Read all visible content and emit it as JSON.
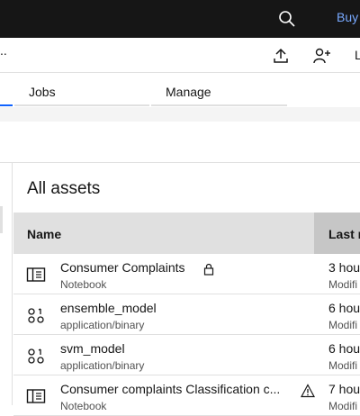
{
  "topbar": {
    "buy_label": "Buy"
  },
  "toolbar": {
    "breadcrumb_ellipsis": "..",
    "more_label": "L"
  },
  "tabs": [
    {
      "label": "Jobs"
    },
    {
      "label": "Manage"
    }
  ],
  "assets": {
    "title": "All assets",
    "columns": {
      "name": "Name",
      "last_modified": "Last m"
    },
    "rows": [
      {
        "name": "Consumer Complaints",
        "type": "Notebook",
        "time": "3 hou",
        "modified": "Modifi",
        "icon": "notebook-icon",
        "badge": "lock-icon"
      },
      {
        "name": "ensemble_model",
        "type": "application/binary",
        "time": "6 hou",
        "modified": "Modifi",
        "icon": "model-icon"
      },
      {
        "name": "svm_model",
        "type": "application/binary",
        "time": "6 hou",
        "modified": "Modifi",
        "icon": "model-icon"
      },
      {
        "name": "Consumer complaints Classification c...",
        "type": "Notebook",
        "time": "7 hou",
        "modified": "Modifi",
        "icon": "notebook-icon",
        "badge": "warning-icon"
      }
    ]
  },
  "colors": {
    "accent": "#0f62fe",
    "topbar": "#161616",
    "link": "#78a9ff"
  }
}
